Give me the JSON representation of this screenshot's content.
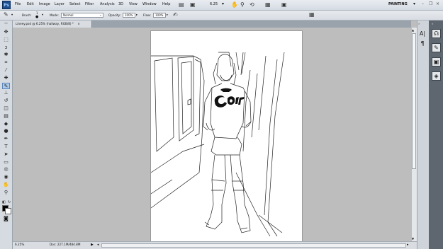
{
  "app": {
    "logo": "Ps",
    "workspace": "PAINTING",
    "zoom_menu": "6.25"
  },
  "menu": [
    "File",
    "Edit",
    "Image",
    "Layer",
    "Select",
    "Filter",
    "Analysis",
    "3D",
    "View",
    "Window",
    "Help"
  ],
  "options_bar": {
    "brush_label": "Brush:",
    "brush_size": "1",
    "mode_label": "Mode:",
    "mode_value": "Normal",
    "opacity_label": "Opacity:",
    "opacity_value": "100%",
    "flow_label": "Flow:",
    "flow_value": "100%"
  },
  "document": {
    "tab_title": "Lineey.psd @ 6.25% (hallway, RGB/8) *",
    "close": "×"
  },
  "status": {
    "zoom": "6.25%",
    "doc_info": "Doc: 227.1M/484.8M"
  },
  "icons": {
    "brush_tool": "✎",
    "arrow": "▸",
    "hand": "✋",
    "zoom": "🔍",
    "rotate": "⟲",
    "screen_mode": "▣",
    "arrange": "▦",
    "minimize": "–",
    "restore": "❐",
    "close_win": "×"
  },
  "toolbar": [
    {
      "name": "move-tool",
      "glyph": "✥"
    },
    {
      "name": "marquee-tool",
      "glyph": "⬚"
    },
    {
      "name": "lasso-tool",
      "glyph": "ↄ"
    },
    {
      "name": "quick-select-tool",
      "glyph": "✱"
    },
    {
      "name": "crop-tool",
      "glyph": "⌗"
    },
    {
      "name": "eyedropper-tool",
      "glyph": "⁄"
    },
    {
      "name": "spot-heal-tool",
      "glyph": "✚"
    },
    {
      "name": "brush-tool",
      "glyph": "✎",
      "active": true
    },
    {
      "name": "clone-stamp-tool",
      "glyph": "⊥"
    },
    {
      "name": "history-brush-tool",
      "glyph": "↺"
    },
    {
      "name": "eraser-tool",
      "glyph": "◫"
    },
    {
      "name": "gradient-tool",
      "glyph": "▤"
    },
    {
      "name": "blur-tool",
      "glyph": "◆"
    },
    {
      "name": "dodge-tool",
      "glyph": "●"
    },
    {
      "name": "pen-tool",
      "glyph": "✒"
    },
    {
      "name": "type-tool",
      "glyph": "T"
    },
    {
      "name": "path-select-tool",
      "glyph": "➤"
    },
    {
      "name": "shape-tool",
      "glyph": "▭"
    },
    {
      "name": "3d-rotate-tool",
      "glyph": "◎"
    },
    {
      "name": "3d-camera-tool",
      "glyph": "◉"
    },
    {
      "name": "hand-tool",
      "glyph": "✋"
    },
    {
      "name": "zoom-tool",
      "glyph": "⚲"
    }
  ],
  "colors": {
    "accent": "#1f4f8f",
    "canvas_bg": "#bdbdbd",
    "active_tool": "#aec8e8"
  }
}
